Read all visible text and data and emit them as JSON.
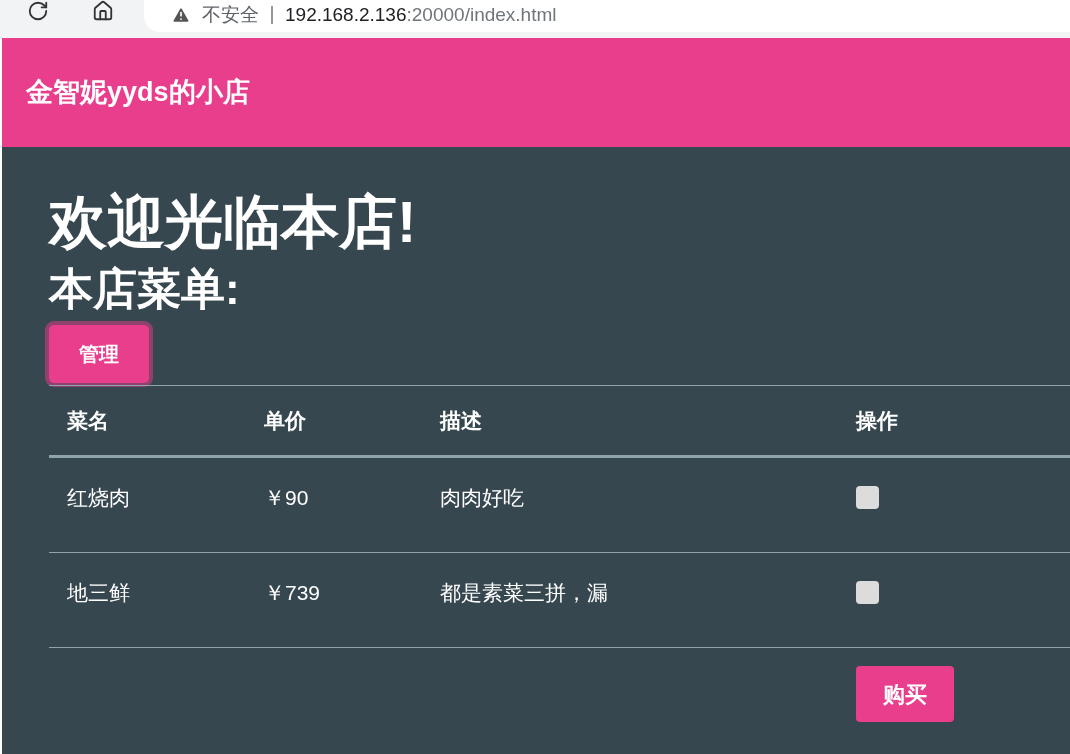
{
  "browser": {
    "security_label": "不安全",
    "url_host": "192.168.2.136",
    "url_rest": ":20000/index.html"
  },
  "navbar": {
    "title": "金智妮yyds的小店"
  },
  "heading": "欢迎光临本店!",
  "subheading": "本店菜单:",
  "manage_button": {
    "label": "管理",
    "focused": true
  },
  "table": {
    "columns": [
      "菜名",
      "单价",
      "描述",
      "操作"
    ],
    "rows": [
      {
        "cells": [
          "红烧肉",
          "￥90",
          "肉肉好吃"
        ],
        "checked": false
      },
      {
        "cells": [
          "地三鲜",
          "￥739",
          "都是素菜三拼，漏"
        ],
        "checked": false
      }
    ]
  },
  "buy_button": {
    "label": "购买"
  }
}
